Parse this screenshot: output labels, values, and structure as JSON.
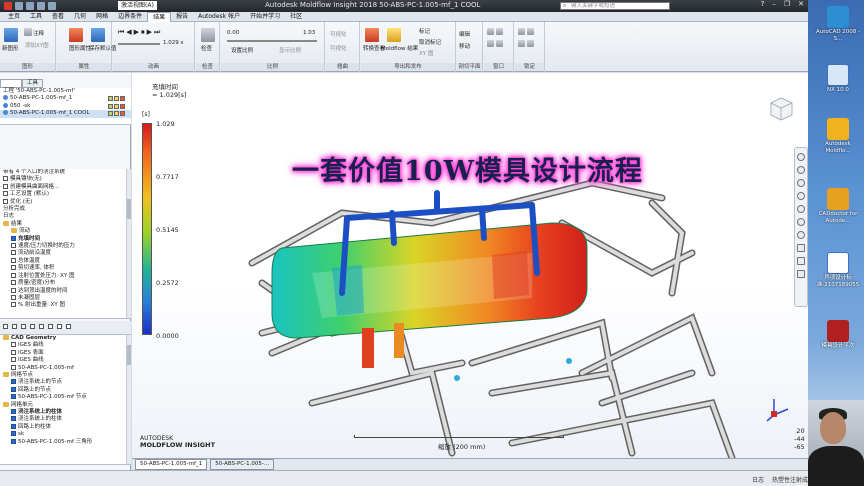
{
  "window": {
    "title": "Autodesk Moldflow Insight 2018    50-ABS-PC-1.005-mf_1 COOL",
    "tab_prefix": "激活视图(A)",
    "search_placeholder": "键入关键字或短语"
  },
  "menu": {
    "tabs": [
      "主页",
      "工具",
      "查看",
      "几何",
      "网格",
      "边界条件",
      "结果",
      "报告",
      "Autodesk 帐户",
      "开始并学习",
      "社区"
    ],
    "active": "结果"
  },
  "ribbon": {
    "groups": [
      {
        "label": "图形",
        "items": [
          "新图形",
          "注释",
          "添加XY图"
        ]
      },
      {
        "label": "属性",
        "items": [
          "图形属性",
          "保存默认值"
        ]
      },
      {
        "label": "动画",
        "items": [
          "1.029 s"
        ]
      },
      {
        "label": "检查",
        "items": [
          "检查"
        ]
      },
      {
        "label": "比例",
        "items": [
          "0.00",
          "1.03",
          "设置比例",
          "显示比例"
        ]
      },
      {
        "label": "翘曲",
        "items": [
          "可视化",
          "可视化"
        ]
      },
      {
        "label": "导出和发布",
        "items": [
          "转换查看",
          "Moldflow 结果",
          "标记",
          "取消标记",
          "XY 图"
        ]
      },
      {
        "label": "剖切平面",
        "items": [
          "编辑",
          "移动"
        ]
      },
      {
        "label": "窗口",
        "items": []
      },
      {
        "label": "锁定",
        "items": []
      }
    ]
  },
  "left_panel": {
    "tabs": [
      "",
      "工具"
    ],
    "project_rows": [
      {
        "text": "工程 '50-ABS-PC-1.005-mf'"
      },
      {
        "text": "50-ABS-PC-1.005-mf_1"
      },
      {
        "text": "050 -sk"
      },
      {
        "text": "50-ABS-PC-1.005-mf_1 COOL",
        "selected": true
      }
    ],
    "study_rows": [
      {
        "text": "带有 4 个入口的浇注系统",
        "kind": "plain"
      },
      {
        "text": "模具镶块(无)",
        "kind": "cb"
      },
      {
        "text": "创建模具曲面网格...",
        "kind": "cb"
      },
      {
        "text": "工艺设置 (默认)",
        "kind": "cb"
      },
      {
        "text": "优化 (无)",
        "kind": "cb"
      },
      {
        "text": "分析完成",
        "kind": "plain"
      },
      {
        "text": "日志",
        "kind": "plain"
      },
      {
        "text": "结果",
        "kind": "fold"
      },
      {
        "text": "流动",
        "kind": "fold",
        "indent": 1
      },
      {
        "text": "充填时间",
        "kind": "cbon",
        "indent": 1,
        "bold": true
      },
      {
        "text": "速度/压力切换时的压力",
        "kind": "cb",
        "indent": 1
      },
      {
        "text": "流动前沿温度",
        "kind": "cb",
        "indent": 1
      },
      {
        "text": "总体温度",
        "kind": "cb",
        "indent": 1
      },
      {
        "text": "剪切速率, 体积",
        "kind": "cb",
        "indent": 1
      },
      {
        "text": "注射位置处压力: XY 图",
        "kind": "cb",
        "indent": 1
      },
      {
        "text": "质量(密度)分布",
        "kind": "cb",
        "indent": 1
      },
      {
        "text": "达到顶出温度的时间",
        "kind": "cb",
        "indent": 1
      },
      {
        "text": "未凝固层",
        "kind": "cb",
        "indent": 1
      },
      {
        "text": "% 射出重量: XY 图",
        "kind": "cb",
        "indent": 1
      }
    ],
    "layer_rows": [
      {
        "text": "CAD Geometry",
        "kind": "fold",
        "bold": true
      },
      {
        "text": "IGES 曲线",
        "kind": "cb",
        "indent": 1
      },
      {
        "text": "IGES 表面",
        "kind": "cb",
        "indent": 1
      },
      {
        "text": "IGES 曲线",
        "kind": "cb",
        "indent": 1
      },
      {
        "text": "50-ABS-PC-1.005-mf",
        "kind": "cb",
        "indent": 1
      },
      {
        "text": "网格节点",
        "kind": "fold"
      },
      {
        "text": "浇注系统上的节点",
        "kind": "cbon",
        "indent": 1
      },
      {
        "text": "回路上的节点",
        "kind": "cbon",
        "indent": 1
      },
      {
        "text": "50-ABS-PC-1.005-mf 节点",
        "kind": "cbon",
        "indent": 1
      },
      {
        "text": "网格单元",
        "kind": "fold"
      },
      {
        "text": "浇注系统上的柱体",
        "kind": "cbon",
        "indent": 1,
        "bold": true
      },
      {
        "text": "浇注系统上的柱体",
        "kind": "cbon",
        "indent": 1
      },
      {
        "text": "回路上的柱体",
        "kind": "cbon",
        "indent": 1
      },
      {
        "text": "sk",
        "kind": "cbon",
        "indent": 1
      },
      {
        "text": "50-ABS-PC-1.005-mf 三角形",
        "kind": "cbon",
        "indent": 1
      }
    ]
  },
  "viewport": {
    "result_name": "充填时间",
    "result_value": "= 1.029[s]",
    "legend_unit": "[s]",
    "legend_ticks": [
      "1.029",
      "0.7717",
      "0.5145",
      "0.2572",
      "0.0000"
    ],
    "overlay_title": "一套价值10W模具设计流程",
    "brand_line1": "AUTODESK",
    "brand_line2": "MOLDFLOW INSIGHT",
    "scale_label": "缩放 (200 mm)",
    "coords": [
      "20",
      "-44",
      "-65"
    ]
  },
  "doc_tabs": [
    "50-ABS-PC-1.005-mf_1",
    "50-ABS-PC-1.005-..."
  ],
  "status": {
    "log": "日志",
    "check": "热塑性注射成型"
  },
  "desktop": {
    "icons": [
      "AutoCAD 2008 - S...",
      "NX 10.0",
      "Autodesk Moldflo...",
      "CADdoctor for Autode...",
      "异项设计标准-2107189055",
      "模具设计平次"
    ]
  },
  "colors": {
    "accent": "#2a6ac9",
    "title_glow": "#ff3fd8",
    "title_text": "#18204d"
  }
}
